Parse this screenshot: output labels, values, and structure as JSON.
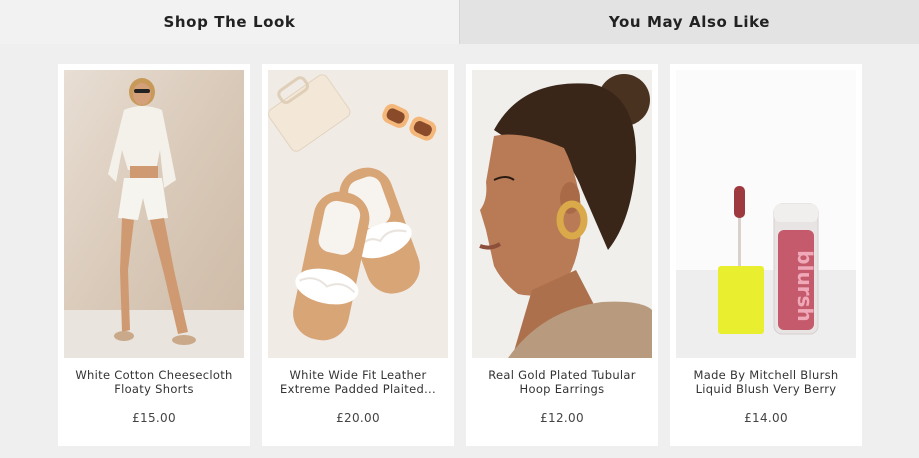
{
  "tabs": [
    {
      "label": "Shop The Look",
      "active": true
    },
    {
      "label": "You May Also Like",
      "active": false
    }
  ],
  "products": [
    {
      "name": "White Cotton Cheesecloth Floaty Shorts",
      "price": "£15.00",
      "image": "model-in-white-shorts-image"
    },
    {
      "name": "White Wide Fit Leather Extreme Padded Plaited...",
      "price": "£20.00",
      "image": "sandals-flatlay-image"
    },
    {
      "name": "Real Gold Plated Tubular Hoop Earrings",
      "price": "£12.00",
      "image": "model-with-hoop-earrings-image"
    },
    {
      "name": "Made By Mitchell Blursh Liquid Blush Very Berry",
      "price": "£14.00",
      "image": "liquid-blush-bottle-image",
      "logo_text": "blursh"
    }
  ],
  "colors": {
    "background": "#efefef",
    "active_tab": "#f2f2f2",
    "inactive_tab": "#e3e3e3",
    "card": "#ffffff"
  }
}
